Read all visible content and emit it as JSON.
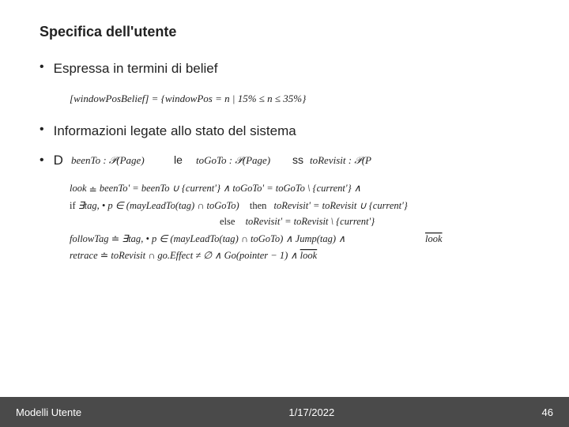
{
  "slide": {
    "title": "Specifica dell'utente",
    "bullets": [
      {
        "id": "bullet1",
        "text": "Espressa in termini di belief"
      },
      {
        "id": "bullet2",
        "text": "Informazioni legate allo stato del sistema"
      },
      {
        "id": "bullet3",
        "text": "D"
      }
    ],
    "formula1": "[windowPosBelief] = {windowPos = n | 15% ≤ n ≤ 35%}",
    "formula3_part1": "beenTo : P(Page)",
    "formula3_part2": "le",
    "formula3_part3": "toGoTo : P(Page)",
    "formula3_part4": "ss",
    "formula3_part5": "toRevisit : P(Page)",
    "look_line": "look ≐ beenTo' = beenTo ∪ {current'} ∧ toGoTo' = toGoTo \\ {current'} ∧",
    "if_line": "if ∃tag, • p ∈ (mayLeadTo(tag) ∩ toGoTo)  then  toRevisit' = toRevisit ∪ {current'}",
    "else_line": "else  toRevisit' = toRevisit \\ {current'}",
    "followtag_line": "followTag ≐ ∃tag, • p ∈ (mayLeadTo(tag) ∩ toGoTo) ∧ Jump(tag) ∧",
    "look_ref": "look",
    "retrace_line": "retrace ≐ toRevisit ∩ go.Effect ≠ ∅ ∧ Go(pointer − 1) ∧ look"
  },
  "footer": {
    "left": "Modelli Utente",
    "center": "1/17/2022",
    "right": "46"
  }
}
